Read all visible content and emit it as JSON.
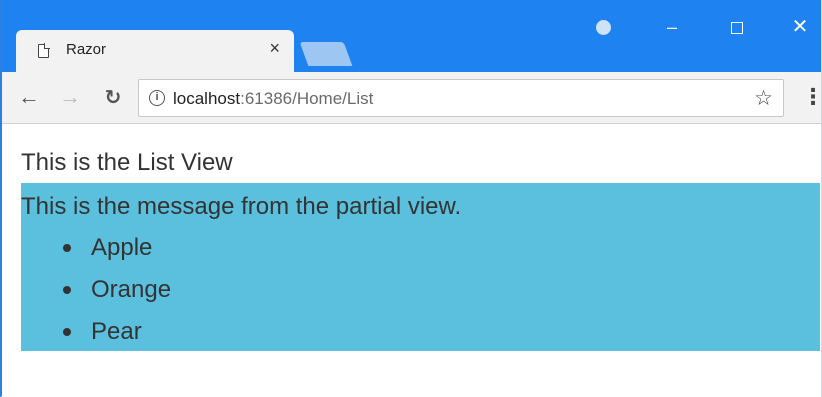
{
  "browser": {
    "tab_title": "Razor",
    "tab_close": "×",
    "window_minimize": "–",
    "window_close": "✕",
    "url_host": "localhost",
    "url_path": ":61386/Home/List",
    "icons": {
      "page": "page-icon",
      "back": "back-arrow-icon",
      "forward": "forward-arrow-icon",
      "reload": "reload-icon",
      "info": "info-icon",
      "star": "star-icon",
      "menu": "kebab-menu-icon",
      "profile": "profile-icon"
    },
    "colors": {
      "titlebar": "#1e83f0",
      "toolbar": "#f2f2f2"
    }
  },
  "page": {
    "heading": "This is the List View",
    "partial": {
      "message": "This is the message from the partial view.",
      "background": "#5bc0de",
      "items": [
        "Apple",
        "Orange",
        "Pear"
      ]
    }
  }
}
